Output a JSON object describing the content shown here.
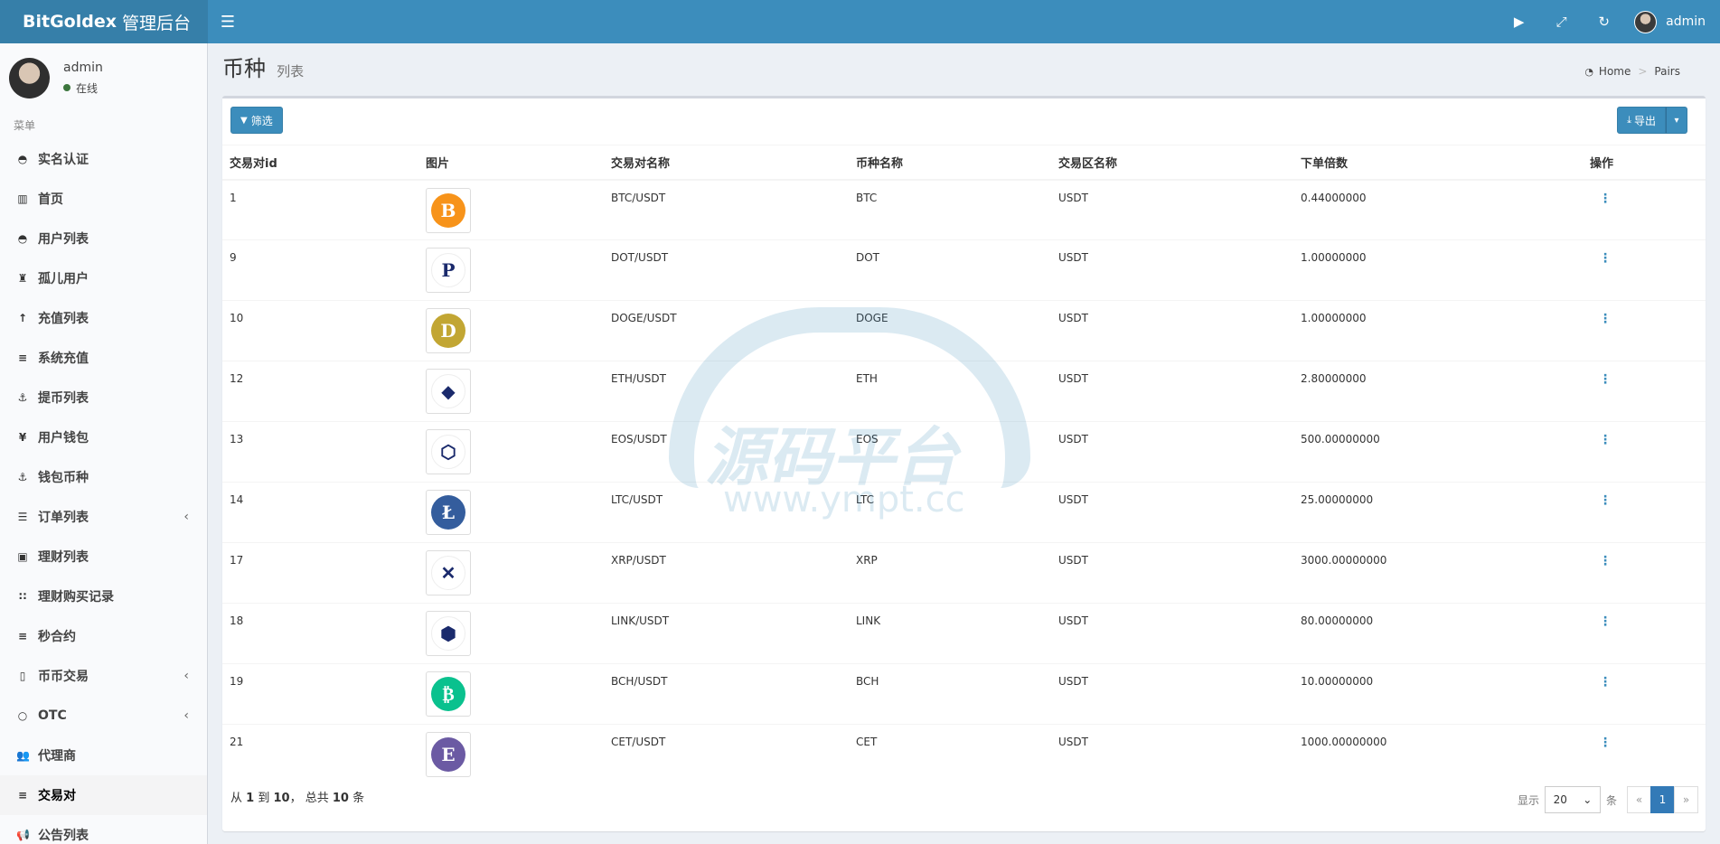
{
  "header": {
    "brand_bold": "BitGoldex",
    "brand_rest": "管理后台",
    "user": "admin"
  },
  "sidebar": {
    "user_name": "admin",
    "status": "在线",
    "menu_title": "菜单",
    "items": [
      {
        "label": "实名认证",
        "icon": "shield-icon",
        "glyph": "◓"
      },
      {
        "label": "首页",
        "icon": "bar-chart-icon",
        "glyph": "▥"
      },
      {
        "label": "用户列表",
        "icon": "users-icon",
        "glyph": "◓"
      },
      {
        "label": "孤儿用户",
        "icon": "child-icon",
        "glyph": "♜"
      },
      {
        "label": "充值列表",
        "icon": "arrow-up-icon",
        "glyph": "↑"
      },
      {
        "label": "系统充值",
        "icon": "list-icon",
        "glyph": "≡"
      },
      {
        "label": "提币列表",
        "icon": "anchor-icon",
        "glyph": "⚓"
      },
      {
        "label": "用户钱包",
        "icon": "yen-icon",
        "glyph": "¥"
      },
      {
        "label": "钱包币种",
        "icon": "anchor-icon",
        "glyph": "⚓"
      },
      {
        "label": "订单列表",
        "icon": "align-icon",
        "glyph": "☰"
      },
      {
        "label": "理财列表",
        "icon": "briefcase-icon",
        "glyph": "▣"
      },
      {
        "label": "理财购买记录",
        "icon": "grid-icon",
        "glyph": "∷"
      },
      {
        "label": "秒合约",
        "icon": "list-icon",
        "glyph": "≡"
      },
      {
        "label": "币币交易",
        "icon": "building-icon",
        "glyph": "▯"
      },
      {
        "label": "OTC",
        "icon": "circle-icon",
        "glyph": "○"
      },
      {
        "label": "代理商",
        "icon": "group-icon",
        "glyph": "👥"
      },
      {
        "label": "交易对",
        "icon": "list-icon",
        "glyph": "≡"
      },
      {
        "label": "公告列表",
        "icon": "bullhorn-icon",
        "glyph": "📢"
      }
    ]
  },
  "page": {
    "title": "币种",
    "subtitle": "列表",
    "breadcrumb_home": "Home",
    "breadcrumb_current": "Pairs"
  },
  "toolbar": {
    "filter_label": "筛选",
    "export_label": "导出"
  },
  "table": {
    "headers": [
      "交易对id",
      "图片",
      "交易对名称",
      "币种名称",
      "交易区名称",
      "下单倍数",
      "操作"
    ],
    "rows": [
      {
        "id": "1",
        "pair": "BTC/USDT",
        "coin": "BTC",
        "zone": "USDT",
        "mult": "0.44000000",
        "logo": "B",
        "color": "#f7931a"
      },
      {
        "id": "9",
        "pair": "DOT/USDT",
        "coin": "DOT",
        "zone": "USDT",
        "mult": "1.00000000",
        "logo": "P",
        "color": "#ffffff"
      },
      {
        "id": "10",
        "pair": "DOGE/USDT",
        "coin": "DOGE",
        "zone": "USDT",
        "mult": "1.00000000",
        "logo": "D",
        "color": "#c2a633"
      },
      {
        "id": "12",
        "pair": "ETH/USDT",
        "coin": "ETH",
        "zone": "USDT",
        "mult": "2.80000000",
        "logo": "◆",
        "color": "#ffffff"
      },
      {
        "id": "13",
        "pair": "EOS/USDT",
        "coin": "EOS",
        "zone": "USDT",
        "mult": "500.00000000",
        "logo": "⬡",
        "color": "#ffffff"
      },
      {
        "id": "14",
        "pair": "LTC/USDT",
        "coin": "LTC",
        "zone": "USDT",
        "mult": "25.00000000",
        "logo": "Ł",
        "color": "#345d9d"
      },
      {
        "id": "17",
        "pair": "XRP/USDT",
        "coin": "XRP",
        "zone": "USDT",
        "mult": "3000.00000000",
        "logo": "✕",
        "color": "#ffffff"
      },
      {
        "id": "18",
        "pair": "LINK/USDT",
        "coin": "LINK",
        "zone": "USDT",
        "mult": "80.00000000",
        "logo": "⬢",
        "color": "#ffffff"
      },
      {
        "id": "19",
        "pair": "BCH/USDT",
        "coin": "BCH",
        "zone": "USDT",
        "mult": "10.00000000",
        "logo": "₿",
        "color": "#0ac18e"
      },
      {
        "id": "21",
        "pair": "CET/USDT",
        "coin": "CET",
        "zone": "USDT",
        "mult": "1000.00000000",
        "logo": "E",
        "color": "#6b5aa3"
      }
    ]
  },
  "footer": {
    "summary_prefix": "从",
    "summary_from": "1",
    "summary_to_word": "到",
    "summary_to": "10",
    "summary_total_word": "， 总共",
    "summary_total": "10",
    "summary_suffix": "条",
    "show_label": "显示",
    "page_size": "20",
    "page_size_suffix": "条",
    "prev": "«",
    "current_page": "1",
    "next": "»"
  },
  "watermark": {
    "text": "源码平台",
    "url": "www.ympt.cc"
  }
}
